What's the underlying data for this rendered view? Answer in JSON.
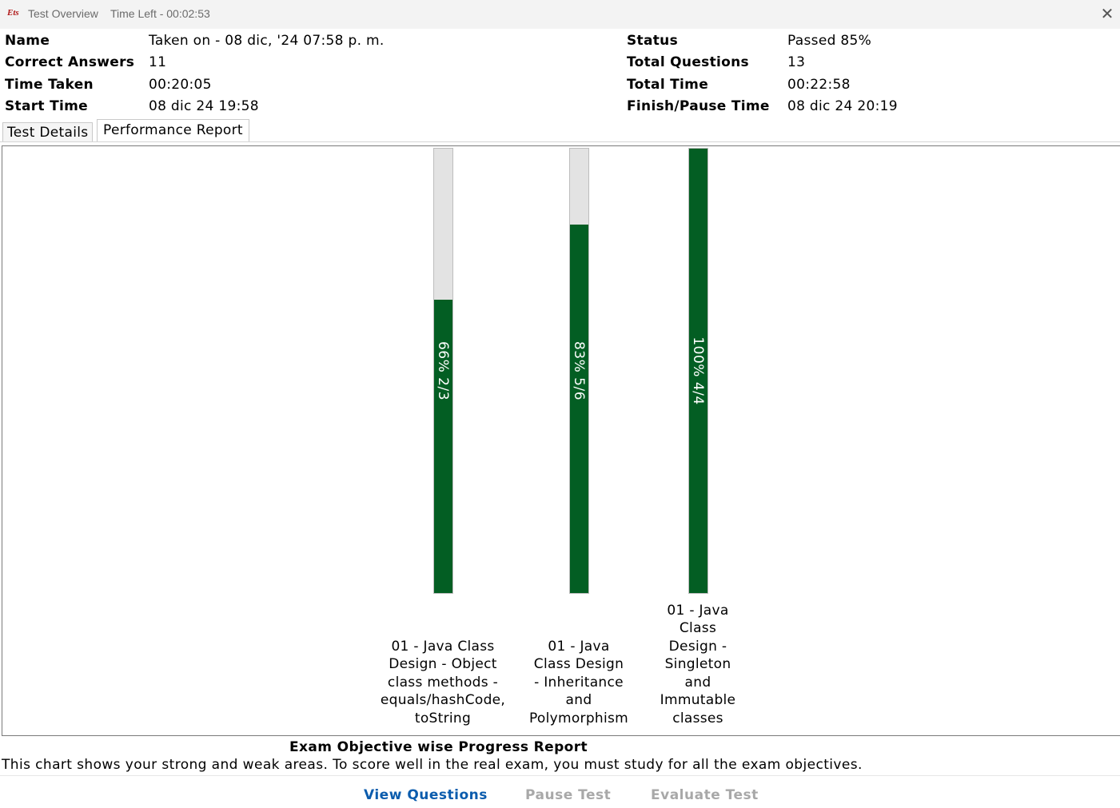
{
  "window": {
    "icon_text": "Ets",
    "title": "Test Overview",
    "time_left": "Time Left - 00:02:53",
    "close_glyph": "✕"
  },
  "summary": {
    "left": [
      {
        "label": "Name",
        "value": "Taken on - 08 dic, '24 07:58 p. m."
      },
      {
        "label": "Correct Answers",
        "value": "11"
      },
      {
        "label": "Time Taken",
        "value": "00:20:05"
      },
      {
        "label": "Start Time",
        "value": "08 dic 24 19:58"
      }
    ],
    "right": [
      {
        "label": "Status",
        "value": "Passed 85%"
      },
      {
        "label": "Total Questions",
        "value": "13"
      },
      {
        "label": "Total Time",
        "value": "00:22:58"
      },
      {
        "label": "Finish/Pause Time",
        "value": "08 dic 24 20:19"
      }
    ]
  },
  "tabs": [
    {
      "label": "Test Details",
      "active": false
    },
    {
      "label": "Performance Report",
      "active": true
    }
  ],
  "chart_data": {
    "type": "bar",
    "orientation": "vertical",
    "categories": [
      "01 - Java Class Design - Object class methods - equals/hashCode, toString",
      "01 - Java Class Design - Inheritance and Polymorphism",
      "01 - Java Class Design - Singleton and Immutable classes"
    ],
    "category_lines": [
      [
        "01 - Java Class",
        "Design - Object",
        "class methods -",
        "equals/hashCode,",
        "toString"
      ],
      [
        "01 - Java",
        "Class Design",
        "- Inheritance",
        "and",
        "Polymorphism"
      ],
      [
        "01 - Java",
        "Class",
        "Design -",
        "Singleton",
        "and",
        "Immutable",
        "classes"
      ]
    ],
    "values": [
      66,
      83,
      100
    ],
    "correct": [
      2,
      5,
      4
    ],
    "total": [
      3,
      6,
      4
    ],
    "bar_labels": [
      "66% 2/3",
      "83% 5/6",
      "100% 4/4"
    ],
    "ylim": [
      0,
      100
    ],
    "fill_color": "#035e23",
    "track_color": "#e3e3e3",
    "grid": false
  },
  "report": {
    "title": "Exam Objective wise Progress Report",
    "description": "This chart shows your strong and weak areas. To score well in the real exam, you must study for all the exam objectives."
  },
  "footer": {
    "view_questions": "View Questions",
    "pause_test": "Pause Test",
    "evaluate_test": "Evaluate Test",
    "active_color": "#0b5cad",
    "disabled_color": "#a8a8a8"
  }
}
